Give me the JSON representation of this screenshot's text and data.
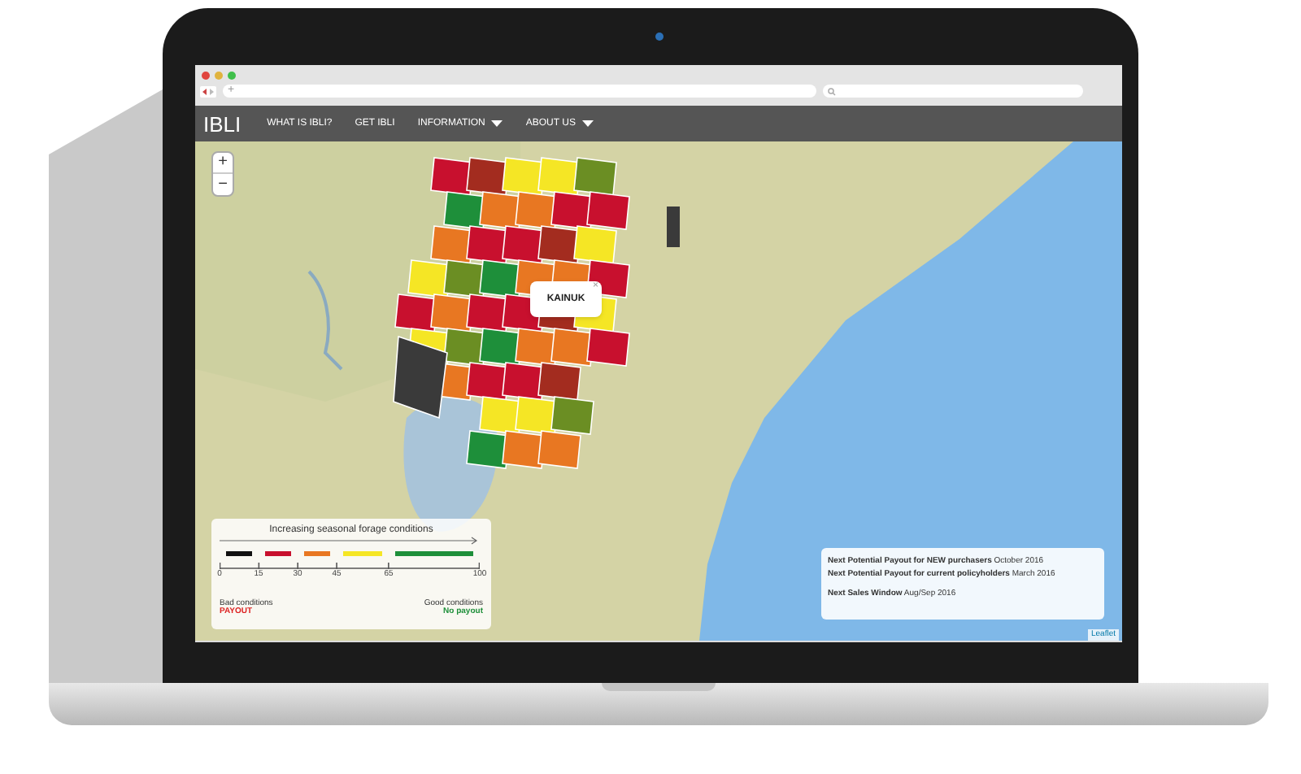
{
  "browser": {
    "address_placeholder": "+"
  },
  "navbar": {
    "brand": "IBLI",
    "items": [
      {
        "label": "WHAT IS IBLI?",
        "has_menu": false
      },
      {
        "label": "GET IBLI",
        "has_menu": false
      },
      {
        "label": "INFORMATION",
        "has_menu": true
      },
      {
        "label": "ABOUT US",
        "has_menu": true
      }
    ]
  },
  "map": {
    "zoom_in": "+",
    "zoom_out": "−",
    "popup": {
      "label": "KAINUK",
      "close": "×"
    },
    "attribution": "Leaflet"
  },
  "legend": {
    "title": "Increasing seasonal forage conditions",
    "segments": [
      {
        "color": "#111111"
      },
      {
        "color": "#c8102e"
      },
      {
        "color": "#e87722"
      },
      {
        "color": "#f5e625"
      },
      {
        "color": "#1e8f3a"
      }
    ],
    "ticks": [
      "0",
      "15",
      "30",
      "45",
      "65",
      "100"
    ],
    "left_label": "Bad conditions",
    "left_status": "PAYOUT",
    "right_label": "Good conditions",
    "right_status": "No payout"
  },
  "info": {
    "lines": [
      "**Next Potential Payout for NEW purchasers** October 2016",
      "**Next Potential Payout for current policyholders** March 2016",
      "**Next Sales Window** Aug/Sep 2016"
    ]
  }
}
